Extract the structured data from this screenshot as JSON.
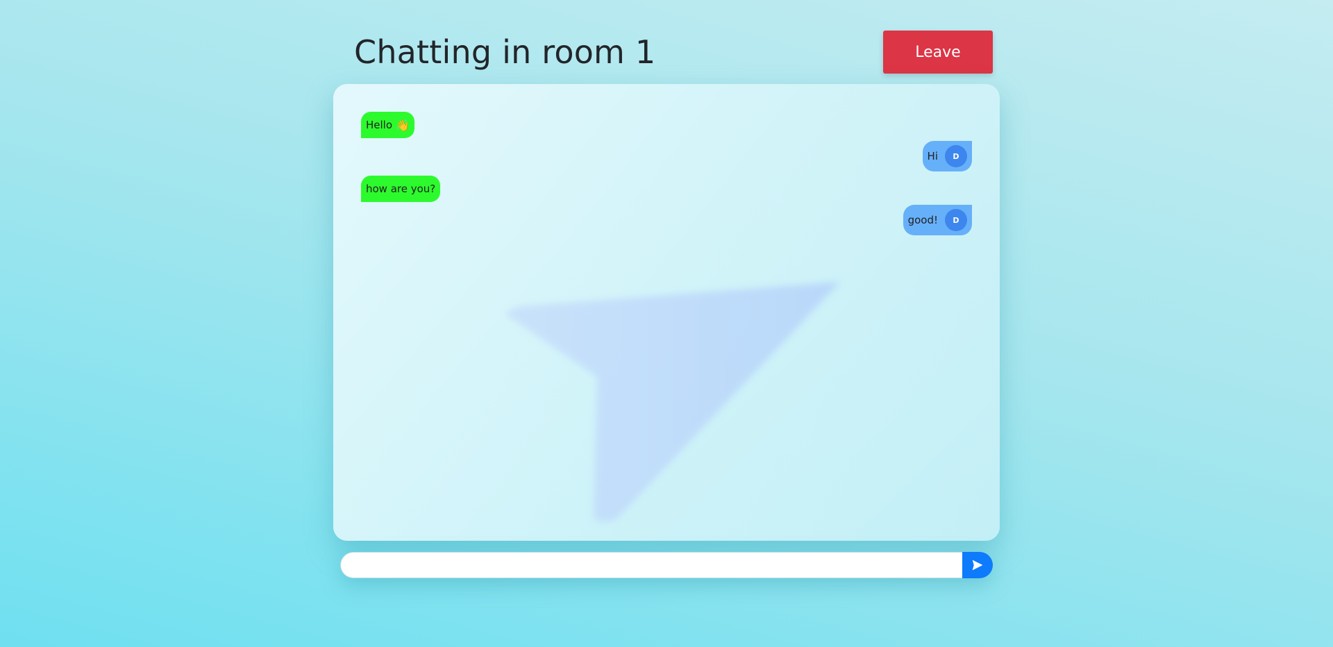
{
  "header": {
    "title": "Chatting in room 1",
    "leave_label": "Leave"
  },
  "messages": [
    {
      "side": "left",
      "text": "Hello",
      "emoji": "👋"
    },
    {
      "side": "right",
      "text": "Hi",
      "avatar": "D"
    },
    {
      "side": "left",
      "text": "how are you?"
    },
    {
      "side": "right",
      "text": "good!",
      "avatar": "D"
    }
  ],
  "composer": {
    "value": "",
    "placeholder": ""
  },
  "colors": {
    "leave_button": "#dc3545",
    "received_bubble": "#2dfa2d",
    "sent_bubble": "#66b0fa",
    "avatar": "#3d86ee",
    "send_button": "#0d7bfc"
  },
  "icons": {
    "background": "paper-plane-icon",
    "send": "send-icon"
  }
}
